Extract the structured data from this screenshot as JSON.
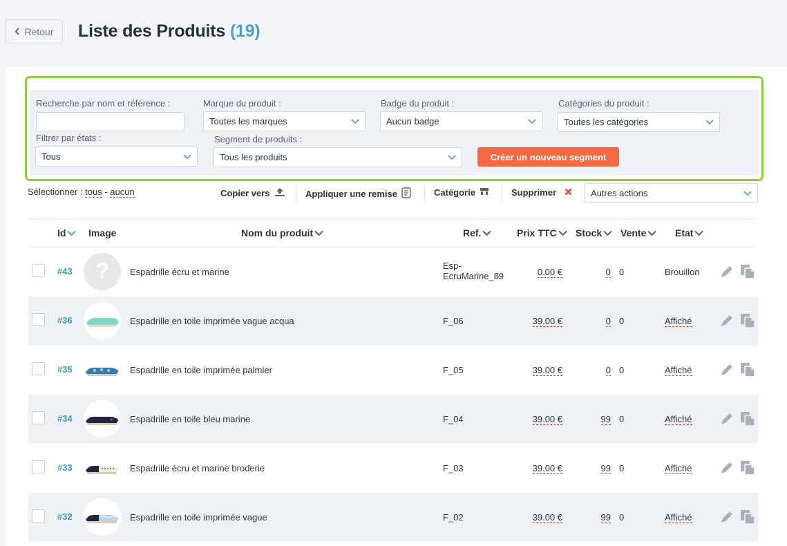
{
  "header": {
    "back_label": "Retour",
    "title": "Liste des Produits",
    "count": "(19)"
  },
  "filters": {
    "search_label": "Recherche par nom et référence :",
    "search_value": "",
    "brand_label": "Marque du produit :",
    "brand_value": "Toutes les marques",
    "badge_label": "Badge du produit :",
    "badge_value": "Aucun badge",
    "categories_label": "Catégories du produit :",
    "categories_value": "Toutes les catégories",
    "state_label": "Filtrer par états :",
    "state_value": "Tous",
    "segment_label": "Segment de produits :",
    "segment_value": "Tous les produits",
    "new_segment_button": "Créer un nouveau segment"
  },
  "bulk": {
    "select_label": "Sélectionner :",
    "all": "tous",
    "dash": "-",
    "none": "aucun",
    "copy_to": "Copier vers",
    "apply_discount": "Appliquer une remise",
    "category": "Catégorie",
    "delete": "Supprimer",
    "other_actions": "Autres actions"
  },
  "table": {
    "headers": {
      "id": "Id",
      "image": "Image",
      "name": "Nom du produit",
      "ref": "Ref.",
      "price": "Prix TTC",
      "stock": "Stock",
      "sales": "Vente",
      "state": "Etat"
    },
    "rows": [
      {
        "id": "#43",
        "name": "Espadrille écru et marine",
        "ref": "Esp-EcruMarine_89",
        "ref_line1": "Esp-",
        "ref_line2": "EcruMarine_89",
        "price": "0.00 €",
        "stock": "0",
        "sales": "0",
        "state": "Brouillon"
      },
      {
        "id": "#36",
        "name": "Espadrille en toile imprimée vague acqua",
        "ref": "F_06",
        "price": "39.00 €",
        "stock": "0",
        "sales": "0",
        "state": "Affiché"
      },
      {
        "id": "#35",
        "name": "Espadrille en toile imprimée palmier",
        "ref": "F_05",
        "price": "39.00 €",
        "stock": "0",
        "sales": "0",
        "state": "Affiché"
      },
      {
        "id": "#34",
        "name": "Espadrille en toile bleu marine",
        "ref": "F_04",
        "price": "39.00 €",
        "stock": "99",
        "sales": "0",
        "state": "Affiché"
      },
      {
        "id": "#33",
        "name": "Espadrille écru et marine broderie",
        "ref": "F_03",
        "price": "39.00 €",
        "stock": "99",
        "sales": "0",
        "state": "Affiché"
      },
      {
        "id": "#32",
        "name": "Espadrille en toile imprimée vague",
        "ref": "F_02",
        "price": "39.00 €",
        "stock": "99",
        "sales": "0",
        "state": "Affiché"
      }
    ]
  },
  "colors": {
    "accent": "#4aa3c8",
    "filter_border": "#8ccf3f",
    "primary_button": "#f56840",
    "delete_icon": "#e0453a"
  },
  "icons": [
    "chevron-left-icon",
    "chevron-down-icon",
    "upload-icon",
    "receipt-icon",
    "store-icon",
    "close-icon",
    "pencil-icon",
    "copy-icon",
    "question-icon"
  ]
}
